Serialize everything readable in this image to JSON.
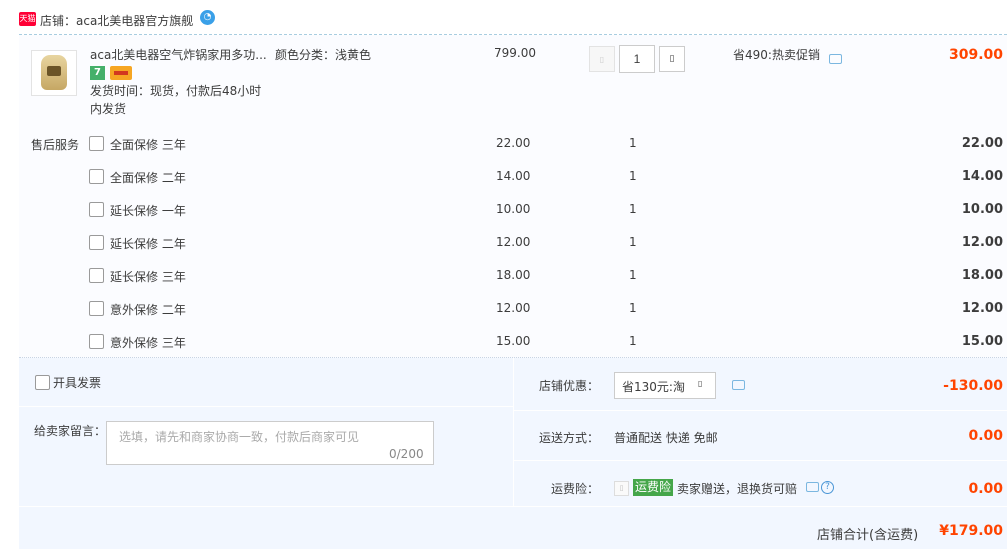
{
  "shop": {
    "badge_text": "天猫",
    "name": "店铺：aca北美电器官方旗舰"
  },
  "item": {
    "name": "aca北美电器空气炸锅家用多功...",
    "color": "颜色分类：浅黄色",
    "badge_7": "7",
    "shipping": "发货时间：现货，付款后48小时内发货",
    "price": "799.00",
    "quantity": "1",
    "promo": "省490:热卖促销",
    "total": "309.00"
  },
  "services": {
    "label": "售后服务",
    "rows": [
      {
        "name": "全面保修 三年",
        "price": "22.00",
        "qty": "1",
        "total": "22.00"
      },
      {
        "name": "全面保修 二年",
        "price": "14.00",
        "qty": "1",
        "total": "14.00"
      },
      {
        "name": "延长保修 一年",
        "price": "10.00",
        "qty": "1",
        "total": "10.00"
      },
      {
        "name": "延长保修 二年",
        "price": "12.00",
        "qty": "1",
        "total": "12.00"
      },
      {
        "name": "延长保修 三年",
        "price": "18.00",
        "qty": "1",
        "total": "18.00"
      },
      {
        "name": "意外保修 二年",
        "price": "12.00",
        "qty": "1",
        "total": "12.00"
      },
      {
        "name": "意外保修 三年",
        "price": "15.00",
        "qty": "1",
        "total": "15.00"
      }
    ]
  },
  "invoice": {
    "label": "开具发票"
  },
  "message": {
    "label": "给卖家留言：",
    "placeholder": "选填，请先和商家协商一致，付款后商家可见",
    "counter": "0/200"
  },
  "discount": {
    "label": "店铺优惠：",
    "selected": "省130元:淘",
    "value": "-130.00"
  },
  "delivery": {
    "label": "运送方式：",
    "text": "普通配送 快递 免邮",
    "value": "0.00"
  },
  "insurance": {
    "label": "运费险：",
    "tag": "运费险",
    "text": "卖家赠送，退换货可赔",
    "value": "0.00"
  },
  "summary": {
    "label": "店铺合计(含运费)",
    "value": "¥179.00"
  },
  "colors": {
    "accent": "#ff4400",
    "tmall_red": "#ff0036",
    "tag_green": "#45a64a",
    "footer_bg": "#f2f7ff"
  }
}
